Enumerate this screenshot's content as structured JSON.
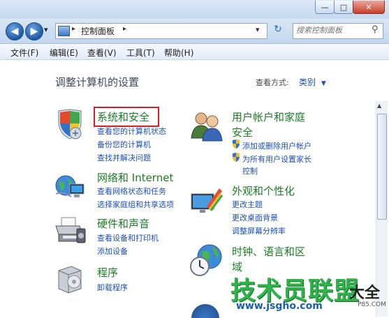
{
  "window": {
    "minimize_glyph": "—",
    "maximize_glyph": "□",
    "close_glyph": "✕"
  },
  "address": {
    "back_glyph": "◀",
    "forward_glyph": "▶",
    "history_glyph": "▾",
    "crumb_sep": "▸",
    "path": "控制面板",
    "path_sep": "▸",
    "dropdown_glyph": "▾",
    "refresh_glyph": "↻",
    "search_placeholder": "搜索控制面板",
    "search_glyph": "⚲"
  },
  "menu": {
    "items": [
      "文件(F)",
      "编辑(E)",
      "查看(V)",
      "工具(T)",
      "帮助(H)"
    ]
  },
  "main": {
    "title": "调整计算机的设置",
    "view_label": "查看方式:",
    "view_value": "类别",
    "view_arrow": "▼"
  },
  "categories": {
    "system_security": {
      "title": "系统和安全",
      "links": [
        "查看您的计算机状态",
        "备份您的计算机",
        "查找并解决问题"
      ]
    },
    "network": {
      "title": "网络和 Internet",
      "links": [
        "查看网络状态和任务",
        "选择家庭组和共享选项"
      ]
    },
    "hardware": {
      "title": "硬件和声音",
      "links": [
        "查看设备和打印机",
        "添加设备"
      ]
    },
    "programs": {
      "title": "程序",
      "links": [
        "卸载程序"
      ]
    },
    "user_accounts": {
      "title_line1": "用户帐户和家庭",
      "title_line2": "安全",
      "links": [
        "添加或删除用户帐户",
        "为所有用户设置家长",
        "控制"
      ]
    },
    "appearance": {
      "title": "外观和个性化",
      "links": [
        "更改主题",
        "更改桌面背景",
        "调整屏幕分辨率"
      ]
    },
    "clock": {
      "title_line1": "时钟、语言和区",
      "title_line2": "域"
    }
  },
  "watermark": {
    "brand": "技术员联盟",
    "url": "www.jsgho.com",
    "extra": "大全",
    "small": "P85.COM"
  },
  "colors": {
    "category_link": "#1b7d24",
    "sub_link": "#1b4fb8",
    "highlight_box": "#d42020"
  }
}
